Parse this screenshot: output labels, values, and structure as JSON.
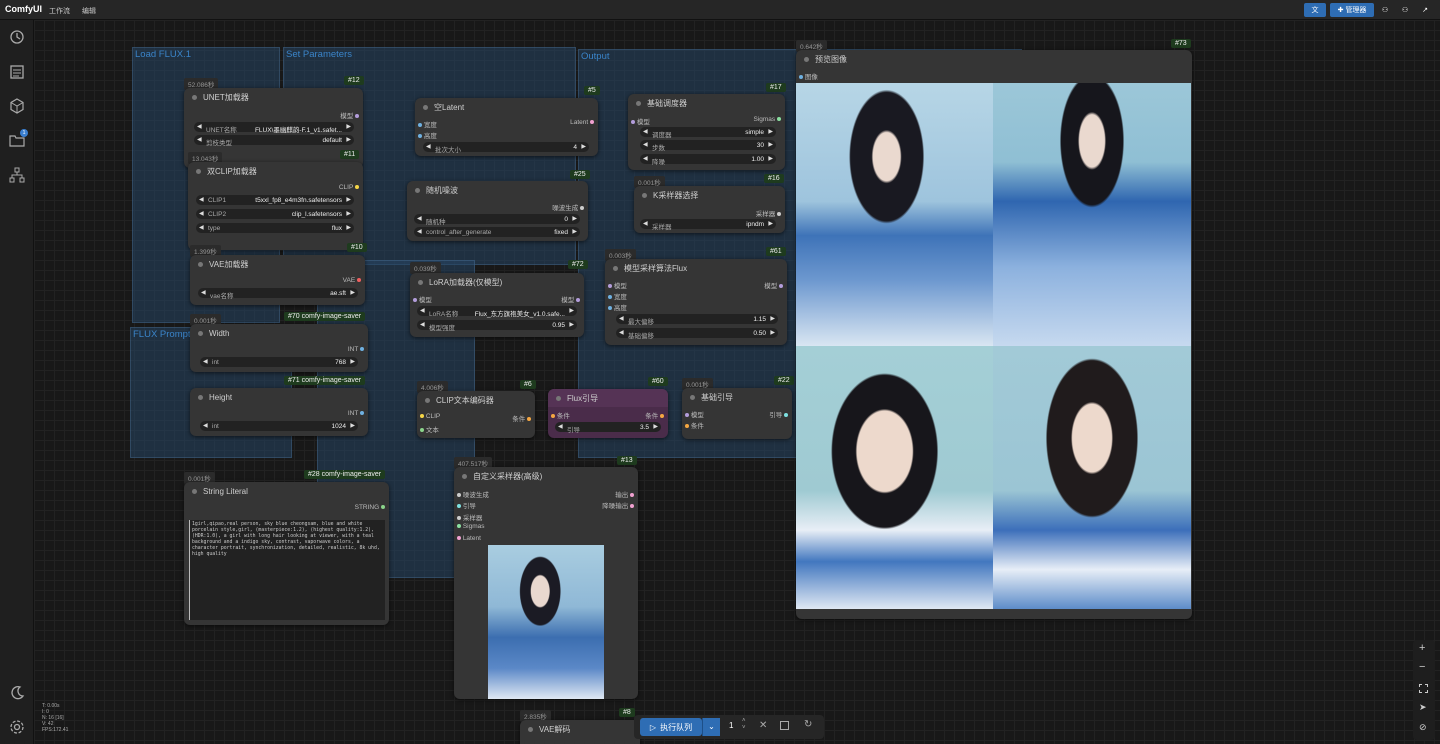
{
  "app": {
    "title": "ComfyUI",
    "menu": [
      "工作流",
      "编辑"
    ],
    "manager_label": "管理器"
  },
  "sidebar": {
    "icons": [
      "history-icon",
      "queue-icon",
      "model-library-icon",
      "workflows-icon",
      "node-map-icon"
    ],
    "bottom": [
      "theme-icon",
      "settings-icon"
    ],
    "badge": "1"
  },
  "groups": [
    {
      "id": "load",
      "title": "Load FLUX.1"
    },
    {
      "id": "params",
      "title": "Set Parameters"
    },
    {
      "id": "output",
      "title": "Output"
    },
    {
      "id": "prompt",
      "title": "FLUX Prompt"
    }
  ],
  "nodes": {
    "n12": {
      "id": "#12",
      "timer": "52.086秒",
      "title": "UNET加载器",
      "out": "模型",
      "w": [
        {
          "l": "UNET名称",
          "v": "FLUX\\墨幽麒韵-F.1_v1.safet..."
        },
        {
          "l": "剪枝类型",
          "v": "default"
        }
      ]
    },
    "n11": {
      "id": "#11",
      "timer": "13.043秒",
      "title": "双CLIP加载器",
      "out": "CLIP",
      "w": [
        {
          "l": "CLIP1",
          "v": "t5xxl_fp8_e4m3fn.safetensors"
        },
        {
          "l": "CLIP2",
          "v": "clip_l.safetensors"
        },
        {
          "l": "type",
          "v": "flux"
        }
      ]
    },
    "n10": {
      "id": "#10",
      "timer": "1.399秒",
      "title": "VAE加载器",
      "out": "VAE",
      "w": [
        {
          "l": "vae名称",
          "v": "ae.sft"
        }
      ]
    },
    "n70": {
      "id": "#70 comfy-image-saver",
      "timer": "0.001秒",
      "title": "Width",
      "out": "INT",
      "w": [
        {
          "l": "int",
          "v": "768"
        }
      ]
    },
    "n71": {
      "id": "#71 comfy-image-saver",
      "title": "Height",
      "out": "INT",
      "w": [
        {
          "l": "int",
          "v": "1024"
        }
      ]
    },
    "n28": {
      "id": "#28 comfy-image-saver",
      "timer": "0.001秒",
      "title": "String Literal",
      "out": "STRING",
      "text": "1girl,qipao,real person, sky blue cheongsam, blue and white porcelain style,girl, (masterpiece:1.2), (highest quality:1.2),(HDR:1.0), a girl with long hair looking at viewer, with a teal background and a indigo sky, contrast, vaporwave colors, a character portrait, synchronization, detailed, realistic, 8k uhd, high quality"
    },
    "n5": {
      "id": "#5",
      "title": "空Latent",
      "in": [
        "宽度",
        "高度"
      ],
      "out": "Latent",
      "w": [
        {
          "l": "批次大小",
          "v": "4"
        }
      ]
    },
    "n25": {
      "id": "#25",
      "title": "随机噪波",
      "out": "噪波生成",
      "w": [
        {
          "l": "随机种",
          "v": "0"
        },
        {
          "l": "control_after_generate",
          "v": "fixed"
        }
      ]
    },
    "n72": {
      "id": "#72",
      "timer": "0.039秒",
      "title": "LoRA加载器(仅模型)",
      "in": [
        "模型"
      ],
      "out": "模型",
      "w": [
        {
          "l": "LoRA名称",
          "v": "Flux_东方旗袍美女_v1.0.safe..."
        },
        {
          "l": "模型强度",
          "v": "0.95"
        }
      ]
    },
    "n6": {
      "id": "#6",
      "timer": "4.006秒",
      "title": "CLIP文本编码器",
      "in": [
        "CLIP",
        "文本"
      ],
      "out": "条件"
    },
    "n60": {
      "id": "#60",
      "title": "Flux引导",
      "in": [
        "条件"
      ],
      "out": "条件",
      "w": [
        {
          "l": "引导",
          "v": "3.5"
        }
      ]
    },
    "n17": {
      "id": "#17",
      "title": "基础调度器",
      "in": [
        "模型"
      ],
      "out": "Sigmas",
      "w": [
        {
          "l": "调度器",
          "v": "simple"
        },
        {
          "l": "步数",
          "v": "30"
        },
        {
          "l": "降噪",
          "v": "1.00"
        }
      ]
    },
    "n16": {
      "id": "#16",
      "timer": "0.001秒",
      "title": "K采样器选择",
      "out": "采样器",
      "w": [
        {
          "l": "采样器",
          "v": "ipndm"
        }
      ]
    },
    "n61": {
      "id": "#61",
      "timer": "0.003秒",
      "title": "模型采样算法Flux",
      "in": [
        "模型",
        "宽度",
        "高度"
      ],
      "out": "模型",
      "w": [
        {
          "l": "最大偏移",
          "v": "1.15"
        },
        {
          "l": "基础偏移",
          "v": "0.50"
        }
      ]
    },
    "n22": {
      "id": "#22",
      "timer": "0.001秒",
      "title": "基础引导",
      "in": [
        "模型",
        "条件"
      ],
      "out": "引导"
    },
    "n13": {
      "id": "#13",
      "timer": "407.517秒",
      "title": "自定义采样器(高级)",
      "in": [
        "噪波生成",
        "引导",
        "采样器",
        "Sigmas",
        "Latent"
      ],
      "out": [
        "输出",
        "降噪输出"
      ]
    },
    "n8": {
      "id": "#8",
      "timer": "2.835秒",
      "title": "VAE解码"
    },
    "n73": {
      "id": "#73",
      "timer": "0.642秒",
      "title": "预览图像",
      "in": [
        "图像"
      ]
    }
  },
  "runbar": {
    "label": "执行队列",
    "count": "1"
  },
  "status": [
    "T: 0.00s",
    "I: 0",
    "N: 16 [16]",
    "V: 42",
    "FPS:172.41"
  ],
  "colors": {
    "accent": "#2e6db4",
    "node": "#353535",
    "canvas": "#181818",
    "group": "#2a4a68",
    "guide": "#4a2c4a"
  }
}
